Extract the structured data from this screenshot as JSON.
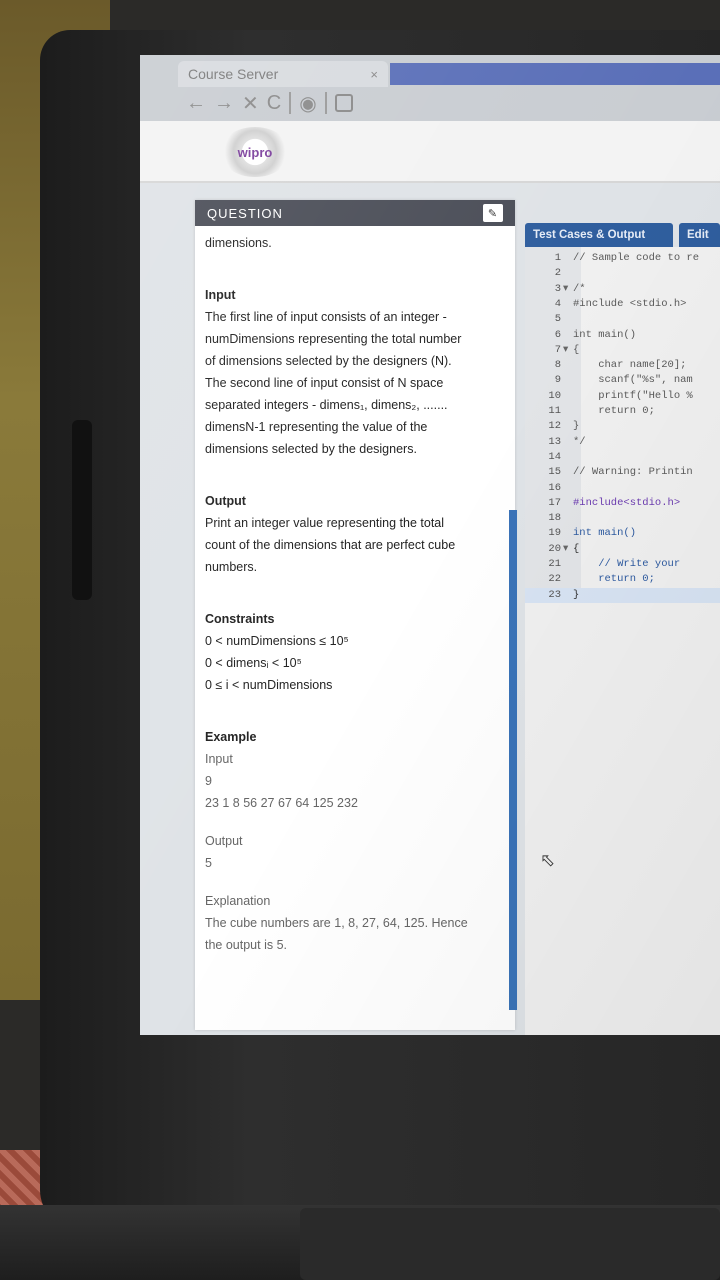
{
  "browser": {
    "tab_title": "Course Server",
    "tab_close": "×",
    "nav": {
      "back": "←",
      "forward": "→",
      "stop": "✕",
      "reload": "C"
    }
  },
  "header": {
    "logo_text": "wipro"
  },
  "question": {
    "header": "QUESTION",
    "pin_icon": "✎",
    "lines": {
      "intro": "dimensions.",
      "input_h": "Input",
      "input_1": "The first line of input consists of an integer -",
      "input_2": "numDimensions representing the total number",
      "input_3": "of dimensions selected by the designers (N).",
      "input_4": "The second line of input consist of N space",
      "input_5": "separated integers - dimens₁, dimens₂, .......",
      "input_6": "dimensN-1 representing the value of the",
      "input_7": "dimensions selected by the designers.",
      "output_h": "Output",
      "output_1": "Print an integer value representing the total",
      "output_2": "count of the dimensions that are perfect cube",
      "output_3": "numbers.",
      "constraints_h": "Constraints",
      "c1": "0 < numDimensions ≤ 10⁵",
      "c2": "0 < dimensᵢ < 10⁵",
      "c3": "0 ≤ i < numDimensions",
      "example_h": "Example",
      "ex_input": "Input",
      "ex_n": "9",
      "ex_vals": "23 1 8 56 27 67 64 125 232",
      "ex_output": "Output",
      "ex_out_val": "5",
      "explanation_h": "Explanation",
      "expl_1": "The cube numbers are 1, 8, 27, 64, 125. Hence",
      "expl_2": "the output is 5."
    }
  },
  "editor": {
    "tabs": [
      "Test Cases & Output",
      "Edit"
    ],
    "lines": [
      {
        "n": "1",
        "f": "",
        "t": "// Sample code to re",
        "c": "cm"
      },
      {
        "n": "2",
        "f": "",
        "t": "",
        "c": ""
      },
      {
        "n": "3",
        "f": "▾",
        "t": "/*",
        "c": "cm"
      },
      {
        "n": "4",
        "f": "",
        "t": "#include <stdio.h>",
        "c": "cm"
      },
      {
        "n": "5",
        "f": "",
        "t": "",
        "c": ""
      },
      {
        "n": "6",
        "f": "",
        "t": "int main()",
        "c": "cm"
      },
      {
        "n": "7",
        "f": "▾",
        "t": "{",
        "c": "cm"
      },
      {
        "n": "8",
        "f": "",
        "t": "    char name[20];",
        "c": "cm"
      },
      {
        "n": "9",
        "f": "",
        "t": "    scanf(\"%s\", nam",
        "c": "cm"
      },
      {
        "n": "10",
        "f": "",
        "t": "    printf(\"Hello %",
        "c": "cm"
      },
      {
        "n": "11",
        "f": "",
        "t": "    return 0;",
        "c": "cm"
      },
      {
        "n": "12",
        "f": "",
        "t": "}",
        "c": "cm"
      },
      {
        "n": "13",
        "f": "",
        "t": "*/",
        "c": "cm"
      },
      {
        "n": "14",
        "f": "",
        "t": "",
        "c": ""
      },
      {
        "n": "15",
        "f": "",
        "t": "// Warning: Printin",
        "c": "cm"
      },
      {
        "n": "16",
        "f": "",
        "t": "",
        "c": ""
      },
      {
        "n": "17",
        "f": "",
        "t": "#include<stdio.h>",
        "c": "pp"
      },
      {
        "n": "18",
        "f": "",
        "t": "",
        "c": ""
      },
      {
        "n": "19",
        "f": "",
        "t": "int main()",
        "c": "kw"
      },
      {
        "n": "20",
        "f": "▾",
        "t": "{",
        "c": ""
      },
      {
        "n": "21",
        "f": "",
        "t": "    // Write your",
        "c": "kw"
      },
      {
        "n": "22",
        "f": "",
        "t": "    return 0;",
        "c": "kw"
      },
      {
        "n": "23",
        "f": "",
        "t": "}",
        "c": ""
      }
    ]
  },
  "colors": {
    "accent": "#2f5e9e",
    "question_header": "#4b4e58",
    "scrollbar": "#3a73b8"
  }
}
